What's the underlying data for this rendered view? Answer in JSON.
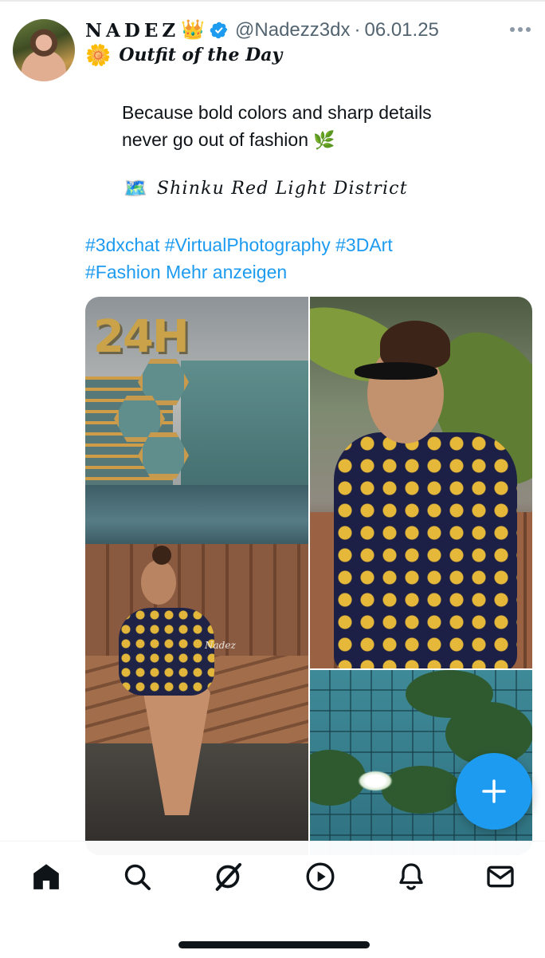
{
  "post": {
    "author": {
      "display_name": "NADEZ",
      "crown_emoji": "👑",
      "handle": "@Nadezz3dx",
      "separator": "·",
      "date": "06.01.25"
    },
    "title_emoji": "🌼",
    "title": "Outfit of the Day",
    "body_line1": "Because bold colors and sharp details",
    "body_line2": "never go out of fashion",
    "leaf_emoji": "🌿",
    "location_emoji": "🗺️",
    "location": "Shinku Red Light District",
    "hashtags": [
      "#3dxchat",
      "#VirtualPhotography",
      "#3DArt",
      "#Fashion"
    ],
    "show_more": "Mehr anzeigen",
    "media": {
      "sign_text": "24H",
      "watermark": "Nadez"
    }
  },
  "colors": {
    "accent": "#1d9bf0",
    "text": "#0f1419",
    "secondary_text": "#536471"
  },
  "nav": {
    "items": [
      "home-icon",
      "search-icon",
      "grok-icon",
      "video-icon",
      "bell-icon",
      "mail-icon"
    ]
  },
  "fab_icon": "plus-icon"
}
